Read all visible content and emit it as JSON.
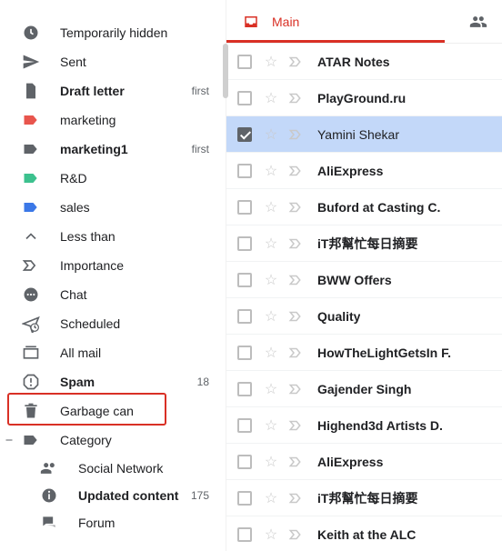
{
  "sidebar": {
    "items": [
      {
        "icon": "clock",
        "label": "Temporarily hidden",
        "bold": false,
        "badge": "",
        "color": "#5f6368"
      },
      {
        "icon": "send",
        "label": "Sent",
        "bold": false,
        "badge": "",
        "color": "#5f6368"
      },
      {
        "icon": "file",
        "label": "Draft letter",
        "bold": true,
        "badge": "first",
        "color": "#5f6368"
      },
      {
        "icon": "tag",
        "label": "marketing",
        "bold": false,
        "badge": "",
        "color": "#e8554d"
      },
      {
        "icon": "tag",
        "label": "marketing1",
        "bold": true,
        "badge": "first",
        "color": "#5f6368"
      },
      {
        "icon": "tag",
        "label": "R&D",
        "bold": false,
        "badge": "",
        "color": "#3cc18e"
      },
      {
        "icon": "tag",
        "label": "sales",
        "bold": false,
        "badge": "",
        "color": "#3b78e7"
      },
      {
        "icon": "chevron-up",
        "label": "Less than",
        "bold": false,
        "badge": "",
        "color": "#5f6368"
      },
      {
        "icon": "importance",
        "label": "Importance",
        "bold": false,
        "badge": "",
        "color": "#5f6368"
      },
      {
        "icon": "chat",
        "label": "Chat",
        "bold": false,
        "badge": "",
        "color": "#5f6368"
      },
      {
        "icon": "scheduled",
        "label": "Scheduled",
        "bold": false,
        "badge": "",
        "color": "#5f6368"
      },
      {
        "icon": "stack",
        "label": "All mail",
        "bold": false,
        "badge": "",
        "color": "#5f6368"
      },
      {
        "icon": "spam",
        "label": "Spam",
        "bold": true,
        "badge": "18",
        "color": "#5f6368"
      },
      {
        "icon": "trash",
        "label": "Garbage can",
        "bold": false,
        "badge": "",
        "color": "#5f6368"
      },
      {
        "icon": "tag",
        "label": "Category",
        "bold": false,
        "badge": "",
        "color": "#5f6368",
        "expand": true
      },
      {
        "icon": "people",
        "label": "Social Network",
        "bold": false,
        "badge": "",
        "color": "#5f6368",
        "nested": true
      },
      {
        "icon": "info",
        "label": "Updated content",
        "bold": true,
        "badge": "175",
        "color": "#5f6368",
        "nested": true
      },
      {
        "icon": "forum",
        "label": "Forum",
        "bold": false,
        "badge": "",
        "color": "#5f6368",
        "nested": true
      }
    ],
    "highlight_index": 13
  },
  "tabs": {
    "main_label": "Main"
  },
  "emails": [
    {
      "sender": "ATAR Notes",
      "selected": false
    },
    {
      "sender": "PlayGround.ru",
      "selected": false
    },
    {
      "sender": "Yamini Shekar",
      "selected": true
    },
    {
      "sender": "AliExpress",
      "selected": false
    },
    {
      "sender": "Buford at Casting C.",
      "selected": false
    },
    {
      "sender": "iT邦幫忙每日摘要",
      "selected": false
    },
    {
      "sender": "BWW Offers",
      "selected": false
    },
    {
      "sender": "Quality",
      "selected": false
    },
    {
      "sender": "HowTheLightGetsIn F.",
      "selected": false
    },
    {
      "sender": "Gajender Singh",
      "selected": false
    },
    {
      "sender": "Highend3d Artists D.",
      "selected": false
    },
    {
      "sender": "AliExpress",
      "selected": false
    },
    {
      "sender": "iT邦幫忙每日摘要",
      "selected": false
    },
    {
      "sender": "Keith at the ALC",
      "selected": false
    }
  ]
}
